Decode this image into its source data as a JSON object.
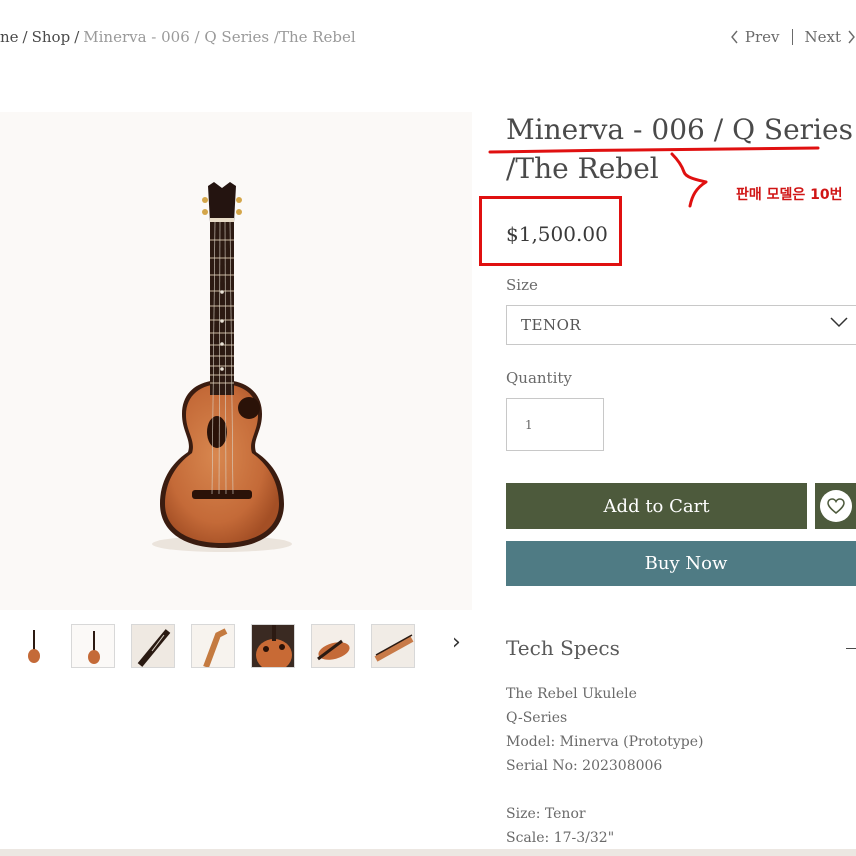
{
  "breadcrumb": {
    "home": "ne",
    "shop": "Shop",
    "current": "Minerva - 006 / Q Series /The Rebel"
  },
  "nav": {
    "prev": "Prev",
    "next": "Next"
  },
  "product": {
    "title_line1": "Minerva - 006 / Q Series",
    "title_line2": "/The Rebel",
    "price": "$1,500.00",
    "size_label": "Size",
    "size_value": "TENOR",
    "quantity_label": "Quantity",
    "quantity_value": "1"
  },
  "buttons": {
    "add_to_cart": "Add to Cart",
    "buy_now": "Buy Now"
  },
  "annotation": {
    "text": "판매 모델은 10번",
    "color": "#d01515"
  },
  "tech_specs": {
    "title": "Tech Specs",
    "lines": [
      "The Rebel Ukulele",
      "Q-Series",
      "Model: Minerva (Prototype)",
      "Serial No: 202308006",
      "",
      "Size: Tenor",
      "Scale: 17-3/32\""
    ]
  },
  "thumbnails": [
    "front-full",
    "front-full-framed",
    "neck-angle",
    "headstock-back",
    "body-closeup",
    "side-lying",
    "side-angle"
  ],
  "colors": {
    "add_to_cart_bg": "#4d5a3c",
    "buy_now_bg": "#4f7b84",
    "annotation_red": "#e01010"
  }
}
